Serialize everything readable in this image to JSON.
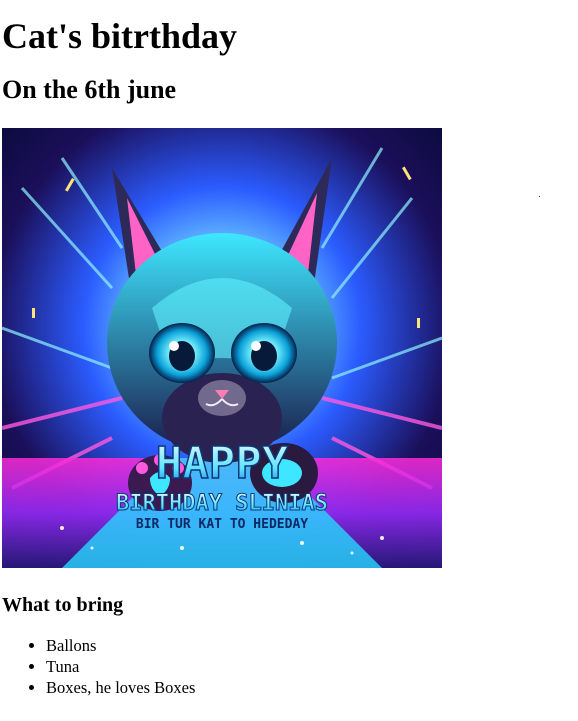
{
  "page": {
    "title": "Cat's bitrthday",
    "subtitle": "On the 6th june"
  },
  "hero_image": {
    "alt": "Neon cyber kitten with HAPPY BIRTHDAY lettering",
    "banner_line1": "HAPPY",
    "banner_line2": "BIRTHDAY SLINIAS",
    "banner_line3": "BIR TUR KAT TO HEDEDAY",
    "palette": [
      "#0a0a3a",
      "#1fd6f2",
      "#ff2bd6",
      "#7a2cff",
      "#ffffff"
    ]
  },
  "bring_section": {
    "heading": "What to bring",
    "items": [
      "Ballons",
      "Tuna",
      "Boxes, he loves Boxes"
    ]
  }
}
